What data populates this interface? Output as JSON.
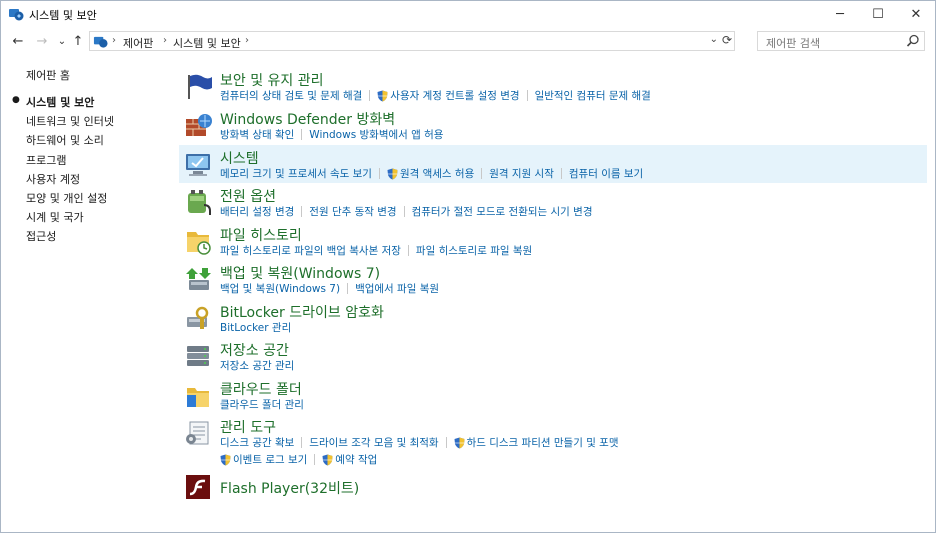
{
  "window": {
    "title": "시스템 및 보안",
    "minimize": "─",
    "maximize": "☐",
    "close": "✕"
  },
  "nav": {
    "back": "←",
    "forward": "→",
    "recent": "⌄",
    "up": "↑",
    "breadcrumb": [
      "제어판",
      "시스템 및 보안"
    ],
    "search_placeholder": "제어판 검색"
  },
  "sidebar": {
    "home": "제어판 홈",
    "items": [
      "시스템 및 보안",
      "네트워크 및 인터넷",
      "하드웨어 및 소리",
      "프로그램",
      "사용자 계정",
      "모양 및 개인 설정",
      "시계 및 국가",
      "접근성"
    ],
    "current_index": 0
  },
  "categories": [
    {
      "title": "보안 및 유지 관리",
      "icon": "flag-icon",
      "rows": [
        [
          {
            "text": "컴퓨터의 상태 검토 및 문제 해결",
            "shield": false
          },
          {
            "text": "사용자 계정 컨트롤 설정 변경",
            "shield": true
          },
          {
            "text": "일반적인 컴퓨터 문제 해결",
            "shield": false
          }
        ]
      ]
    },
    {
      "title": "Windows Defender 방화벽",
      "icon": "firewall-icon",
      "rows": [
        [
          {
            "text": "방화벽 상태 확인",
            "shield": false
          },
          {
            "text": "Windows 방화벽에서 앱 허용",
            "shield": false
          }
        ]
      ]
    },
    {
      "title": "시스템",
      "icon": "system-icon",
      "highlighted": true,
      "rows": [
        [
          {
            "text": "메모리 크기 및 프로세서 속도 보기",
            "shield": false
          },
          {
            "text": "원격 액세스 허용",
            "shield": true
          },
          {
            "text": "원격 지원 시작",
            "shield": false
          },
          {
            "text": "컴퓨터 이름 보기",
            "shield": false
          }
        ]
      ]
    },
    {
      "title": "전원 옵션",
      "icon": "power-icon",
      "rows": [
        [
          {
            "text": "배터리 설정 변경",
            "shield": false
          },
          {
            "text": "전원 단추 동작 변경",
            "shield": false
          },
          {
            "text": "컴퓨터가 절전 모드로 전환되는 시기 변경",
            "shield": false
          }
        ]
      ]
    },
    {
      "title": "파일 히스토리",
      "icon": "file-history-icon",
      "rows": [
        [
          {
            "text": "파일 히스토리로 파일의 백업 복사본 저장",
            "shield": false
          },
          {
            "text": "파일 히스토리로 파일 복원",
            "shield": false
          }
        ]
      ]
    },
    {
      "title": "백업 및 복원(Windows 7)",
      "icon": "backup-icon",
      "rows": [
        [
          {
            "text": "백업 및 복원(Windows 7)",
            "shield": false
          },
          {
            "text": "백업에서 파일 복원",
            "shield": false
          }
        ]
      ]
    },
    {
      "title": "BitLocker 드라이브 암호화",
      "icon": "bitlocker-icon",
      "rows": [
        [
          {
            "text": "BitLocker 관리",
            "shield": false
          }
        ]
      ]
    },
    {
      "title": "저장소 공간",
      "icon": "storage-icon",
      "rows": [
        [
          {
            "text": "저장소 공간 관리",
            "shield": false
          }
        ]
      ]
    },
    {
      "title": "클라우드 폴더",
      "icon": "cloud-folder-icon",
      "rows": [
        [
          {
            "text": "클라우드 폴더 관리",
            "shield": false
          }
        ]
      ]
    },
    {
      "title": "관리 도구",
      "icon": "admin-tools-icon",
      "rows": [
        [
          {
            "text": "디스크 공간 확보",
            "shield": false
          },
          {
            "text": "드라이브 조각 모음 및 최적화",
            "shield": false
          },
          {
            "text": "하드 디스크 파티션 만들기 및 포맷",
            "shield": true
          }
        ],
        [
          {
            "text": "이벤트 로그 보기",
            "shield": true
          },
          {
            "text": "예약 작업",
            "shield": true
          }
        ]
      ]
    },
    {
      "title": "Flash Player(32비트)",
      "icon": "flash-icon",
      "rows": []
    }
  ]
}
